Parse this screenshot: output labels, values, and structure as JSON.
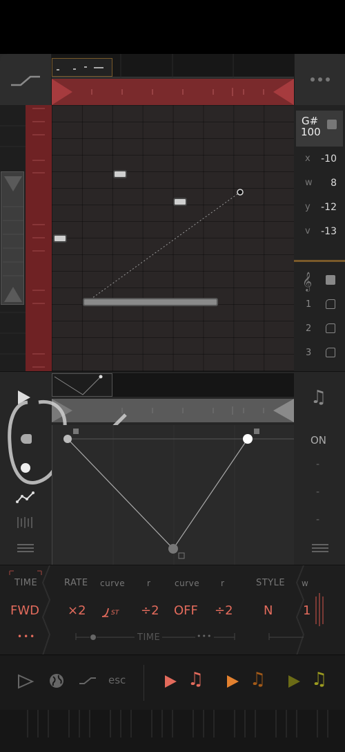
{
  "inspector": {
    "note": {
      "name": "G#",
      "velocity": "100"
    },
    "rows": [
      {
        "key": "x",
        "value": "-10"
      },
      {
        "key": "w",
        "value": "8"
      },
      {
        "key": "y",
        "value": "-12"
      },
      {
        "key": "v",
        "value": "-13"
      }
    ],
    "layers": [
      "1",
      "2",
      "3"
    ]
  },
  "envelope": {
    "toggle_label": "ON",
    "right_dashes": [
      "-",
      "-",
      "-"
    ]
  },
  "params": {
    "labels": [
      "TIME",
      "RATE",
      "curve",
      "r",
      "curve",
      "r",
      "STYLE",
      "w"
    ],
    "values": [
      "FWD",
      "×2",
      "ST",
      "÷2",
      "OFF",
      "÷2",
      "N",
      "1"
    ],
    "more": "•••",
    "time_group": "TIME"
  },
  "toolbar": {
    "esc_label": "esc"
  },
  "colors": {
    "accent_red": "#e36b5c",
    "ruler_red": "#7a2a2c",
    "play_red": "#e36b5c",
    "play_orange": "#e3812f",
    "play_olive": "#6b6b16",
    "note_orange": "#a35a18",
    "note_olive": "#9c9c20"
  },
  "icons": [
    "mode-ramp-icon",
    "more-dots-icon",
    "play-icon",
    "music-note-icon",
    "record-icon",
    "dot-icon",
    "envelope-icon",
    "barcode-icon",
    "menu-icon",
    "play-outline-icon",
    "globe-icon",
    "ramp-icon",
    "treble-clef-icon",
    "square-icon"
  ]
}
